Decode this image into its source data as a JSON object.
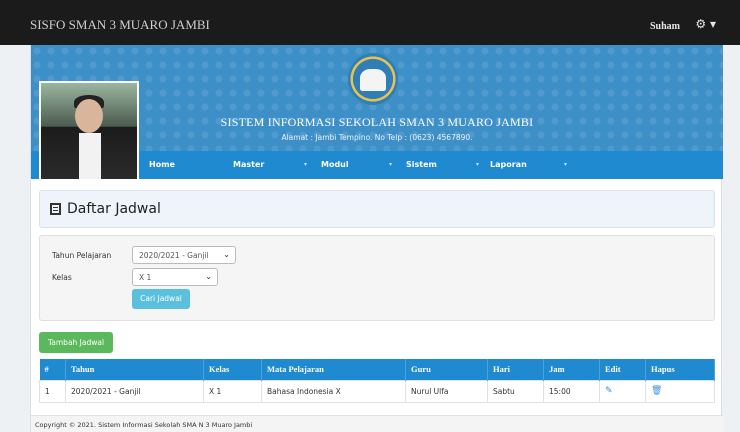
{
  "topbar": {
    "brand": "SISFO SMAN 3 MUARO JAMBI",
    "user": "Suham",
    "settings_icon": "gear-icon",
    "settings_caret": "▾"
  },
  "banner": {
    "title": "SISTEM INFORMASI SEKOLAH SMAN 3 MUARO JAMBI",
    "address": "Alamat : Jambi Tempino. No Telp : (0623) 4567890."
  },
  "nav": {
    "items": [
      "Home",
      "Master",
      "Modul",
      "Sistem",
      "Laporan"
    ],
    "caret": "▾"
  },
  "page": {
    "heading": "Daftar Jadwal"
  },
  "filter": {
    "tahun_label": "Tahun Pelajaran",
    "tahun_value": "2020/2021 - Ganjil",
    "kelas_label": "Kelas",
    "kelas_value": "X 1",
    "search_button": "Cari Jadwal"
  },
  "actions": {
    "add_button": "Tambah Jadwal"
  },
  "table": {
    "headers": [
      "#",
      "Tahun",
      "Kelas",
      "Mata Pelajaran",
      "Guru",
      "Hari",
      "Jam",
      "Edit",
      "Hapus"
    ],
    "rows": [
      [
        "1",
        "2020/2021 - Ganjil",
        "X 1",
        "Bahasa Indonesia X",
        "Nurul Ulfa",
        "Sabtu",
        "15:00"
      ]
    ]
  },
  "footer": {
    "text": "Copyright © 2021. Sistem Informasi Sekolah SMA N 3 Muaro Jambi"
  },
  "colors": {
    "topbar": "#1b1b1b",
    "banner": "#3d8fc7",
    "nav": "#1f8ad0",
    "info_button": "#5bc0de",
    "success_button": "#5cb85c"
  }
}
